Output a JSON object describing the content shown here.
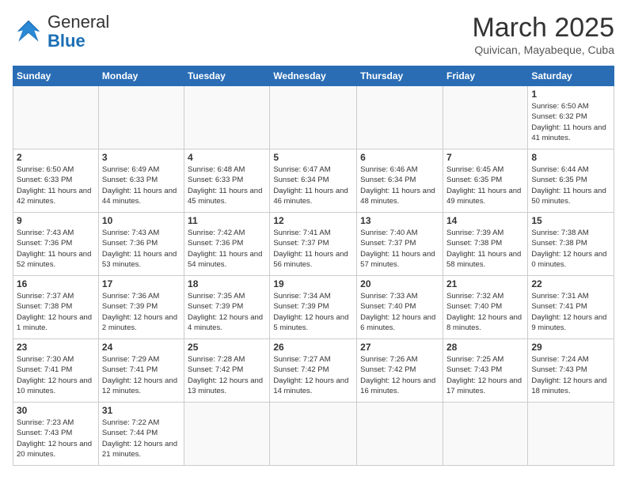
{
  "header": {
    "logo_general": "General",
    "logo_blue": "Blue",
    "month_year": "March 2025",
    "location": "Quivican, Mayabeque, Cuba"
  },
  "days_of_week": [
    "Sunday",
    "Monday",
    "Tuesday",
    "Wednesday",
    "Thursday",
    "Friday",
    "Saturday"
  ],
  "weeks": [
    [
      {
        "day": "",
        "info": ""
      },
      {
        "day": "",
        "info": ""
      },
      {
        "day": "",
        "info": ""
      },
      {
        "day": "",
        "info": ""
      },
      {
        "day": "",
        "info": ""
      },
      {
        "day": "",
        "info": ""
      },
      {
        "day": "1",
        "info": "Sunrise: 6:50 AM\nSunset: 6:32 PM\nDaylight: 11 hours and 41 minutes."
      }
    ],
    [
      {
        "day": "2",
        "info": "Sunrise: 6:50 AM\nSunset: 6:33 PM\nDaylight: 11 hours and 42 minutes."
      },
      {
        "day": "3",
        "info": "Sunrise: 6:49 AM\nSunset: 6:33 PM\nDaylight: 11 hours and 44 minutes."
      },
      {
        "day": "4",
        "info": "Sunrise: 6:48 AM\nSunset: 6:33 PM\nDaylight: 11 hours and 45 minutes."
      },
      {
        "day": "5",
        "info": "Sunrise: 6:47 AM\nSunset: 6:34 PM\nDaylight: 11 hours and 46 minutes."
      },
      {
        "day": "6",
        "info": "Sunrise: 6:46 AM\nSunset: 6:34 PM\nDaylight: 11 hours and 48 minutes."
      },
      {
        "day": "7",
        "info": "Sunrise: 6:45 AM\nSunset: 6:35 PM\nDaylight: 11 hours and 49 minutes."
      },
      {
        "day": "8",
        "info": "Sunrise: 6:44 AM\nSunset: 6:35 PM\nDaylight: 11 hours and 50 minutes."
      }
    ],
    [
      {
        "day": "9",
        "info": "Sunrise: 7:43 AM\nSunset: 7:36 PM\nDaylight: 11 hours and 52 minutes."
      },
      {
        "day": "10",
        "info": "Sunrise: 7:43 AM\nSunset: 7:36 PM\nDaylight: 11 hours and 53 minutes."
      },
      {
        "day": "11",
        "info": "Sunrise: 7:42 AM\nSunset: 7:36 PM\nDaylight: 11 hours and 54 minutes."
      },
      {
        "day": "12",
        "info": "Sunrise: 7:41 AM\nSunset: 7:37 PM\nDaylight: 11 hours and 56 minutes."
      },
      {
        "day": "13",
        "info": "Sunrise: 7:40 AM\nSunset: 7:37 PM\nDaylight: 11 hours and 57 minutes."
      },
      {
        "day": "14",
        "info": "Sunrise: 7:39 AM\nSunset: 7:38 PM\nDaylight: 11 hours and 58 minutes."
      },
      {
        "day": "15",
        "info": "Sunrise: 7:38 AM\nSunset: 7:38 PM\nDaylight: 12 hours and 0 minutes."
      }
    ],
    [
      {
        "day": "16",
        "info": "Sunrise: 7:37 AM\nSunset: 7:38 PM\nDaylight: 12 hours and 1 minute."
      },
      {
        "day": "17",
        "info": "Sunrise: 7:36 AM\nSunset: 7:39 PM\nDaylight: 12 hours and 2 minutes."
      },
      {
        "day": "18",
        "info": "Sunrise: 7:35 AM\nSunset: 7:39 PM\nDaylight: 12 hours and 4 minutes."
      },
      {
        "day": "19",
        "info": "Sunrise: 7:34 AM\nSunset: 7:39 PM\nDaylight: 12 hours and 5 minutes."
      },
      {
        "day": "20",
        "info": "Sunrise: 7:33 AM\nSunset: 7:40 PM\nDaylight: 12 hours and 6 minutes."
      },
      {
        "day": "21",
        "info": "Sunrise: 7:32 AM\nSunset: 7:40 PM\nDaylight: 12 hours and 8 minutes."
      },
      {
        "day": "22",
        "info": "Sunrise: 7:31 AM\nSunset: 7:41 PM\nDaylight: 12 hours and 9 minutes."
      }
    ],
    [
      {
        "day": "23",
        "info": "Sunrise: 7:30 AM\nSunset: 7:41 PM\nDaylight: 12 hours and 10 minutes."
      },
      {
        "day": "24",
        "info": "Sunrise: 7:29 AM\nSunset: 7:41 PM\nDaylight: 12 hours and 12 minutes."
      },
      {
        "day": "25",
        "info": "Sunrise: 7:28 AM\nSunset: 7:42 PM\nDaylight: 12 hours and 13 minutes."
      },
      {
        "day": "26",
        "info": "Sunrise: 7:27 AM\nSunset: 7:42 PM\nDaylight: 12 hours and 14 minutes."
      },
      {
        "day": "27",
        "info": "Sunrise: 7:26 AM\nSunset: 7:42 PM\nDaylight: 12 hours and 16 minutes."
      },
      {
        "day": "28",
        "info": "Sunrise: 7:25 AM\nSunset: 7:43 PM\nDaylight: 12 hours and 17 minutes."
      },
      {
        "day": "29",
        "info": "Sunrise: 7:24 AM\nSunset: 7:43 PM\nDaylight: 12 hours and 18 minutes."
      }
    ],
    [
      {
        "day": "30",
        "info": "Sunrise: 7:23 AM\nSunset: 7:43 PM\nDaylight: 12 hours and 20 minutes."
      },
      {
        "day": "31",
        "info": "Sunrise: 7:22 AM\nSunset: 7:44 PM\nDaylight: 12 hours and 21 minutes."
      },
      {
        "day": "",
        "info": ""
      },
      {
        "day": "",
        "info": ""
      },
      {
        "day": "",
        "info": ""
      },
      {
        "day": "",
        "info": ""
      },
      {
        "day": "",
        "info": ""
      }
    ]
  ]
}
